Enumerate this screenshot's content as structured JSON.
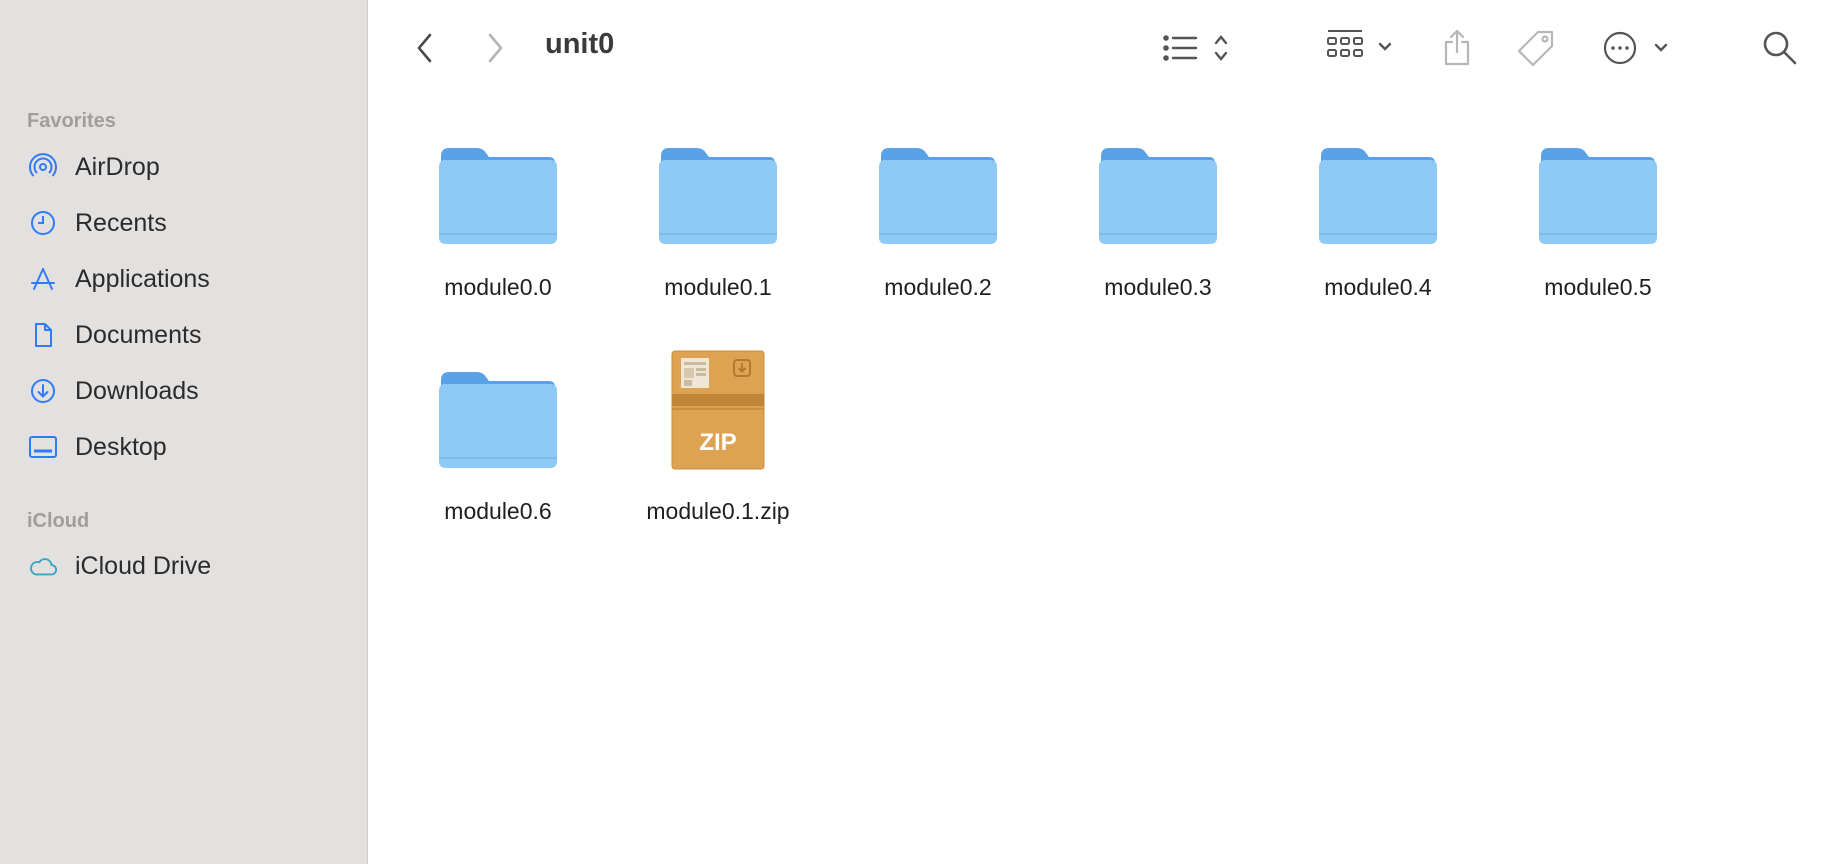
{
  "window": {
    "title": "unit0"
  },
  "sidebar": {
    "favorites_title": "Favorites",
    "favorites": [
      {
        "label": "AirDrop",
        "icon": "airdrop-icon"
      },
      {
        "label": "Recents",
        "icon": "clock-icon"
      },
      {
        "label": "Applications",
        "icon": "applications-icon"
      },
      {
        "label": "Documents",
        "icon": "document-icon"
      },
      {
        "label": "Downloads",
        "icon": "download-icon"
      },
      {
        "label": "Desktop",
        "icon": "desktop-icon"
      }
    ],
    "icloud_title": "iCloud",
    "icloud": [
      {
        "label": "iCloud Drive",
        "icon": "cloud-icon"
      }
    ]
  },
  "toolbar": {
    "back": "chevron-left-icon",
    "forward": "chevron-right-icon",
    "list_view": "list-view-icon",
    "grid_view": "grid-view-icon",
    "share": "share-icon",
    "tag": "tag-icon",
    "more": "ellipsis-circle-icon",
    "search": "search-icon"
  },
  "files": [
    {
      "name": "module0.0",
      "type": "folder"
    },
    {
      "name": "module0.1",
      "type": "folder"
    },
    {
      "name": "module0.2",
      "type": "folder"
    },
    {
      "name": "module0.3",
      "type": "folder"
    },
    {
      "name": "module0.4",
      "type": "folder"
    },
    {
      "name": "module0.5",
      "type": "folder"
    },
    {
      "name": "module0.6",
      "type": "folder"
    },
    {
      "name": "module0.1.zip",
      "type": "zip",
      "badge": "ZIP"
    }
  ],
  "colors": {
    "sidebar_bg": "#e3e1e0",
    "accent_icon": "#2f7bf5",
    "folder_front": "#8fcaf6",
    "folder_back": "#5aa2e8",
    "zip_box": "#dda352"
  }
}
